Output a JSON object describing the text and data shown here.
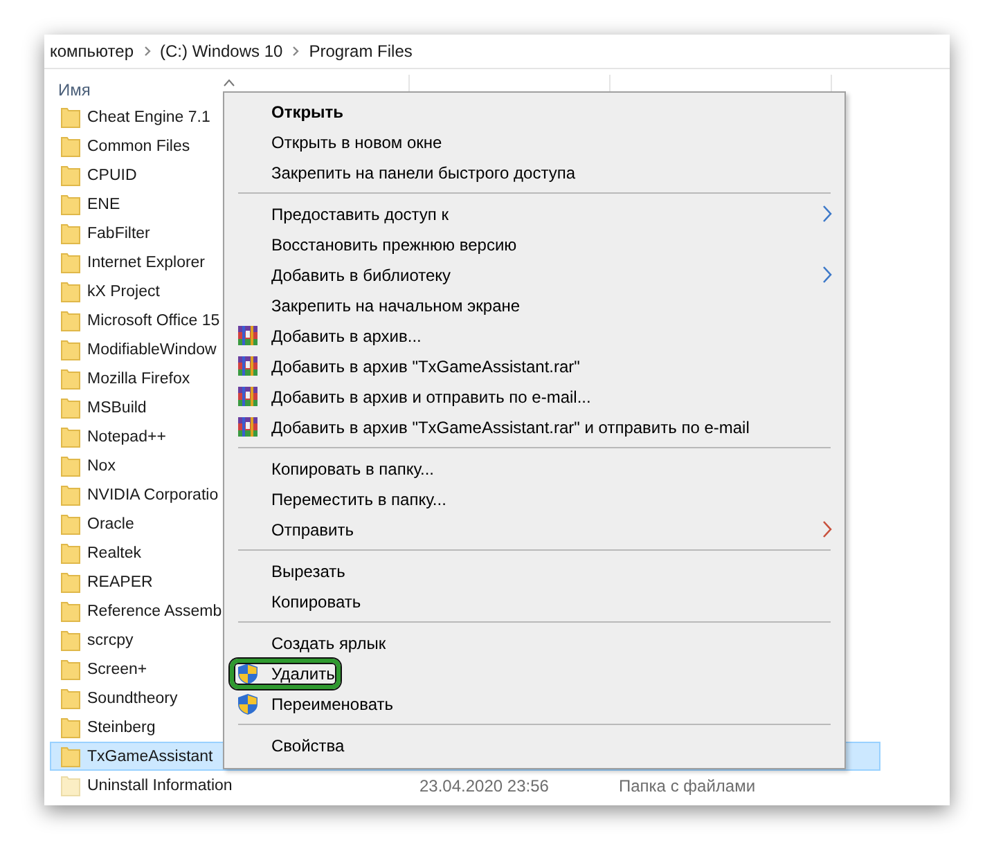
{
  "breadcrumb": [
    "компьютер",
    "(C:) Windows 10",
    "Program Files"
  ],
  "columns": [
    {
      "label": "Имя"
    }
  ],
  "rows": [
    {
      "name": "Cheat Engine 7.1",
      "selected": false,
      "dimmed": false
    },
    {
      "name": "Common Files",
      "selected": false,
      "dimmed": false
    },
    {
      "name": "CPUID",
      "selected": false,
      "dimmed": false
    },
    {
      "name": "ENE",
      "selected": false,
      "dimmed": false
    },
    {
      "name": "FabFilter",
      "selected": false,
      "dimmed": false
    },
    {
      "name": "Internet Explorer",
      "selected": false,
      "dimmed": false
    },
    {
      "name": "kX Project",
      "selected": false,
      "dimmed": false
    },
    {
      "name": "Microsoft Office 15",
      "selected": false,
      "dimmed": false
    },
    {
      "name": "ModifiableWindow",
      "selected": false,
      "dimmed": false
    },
    {
      "name": "Mozilla Firefox",
      "selected": false,
      "dimmed": false
    },
    {
      "name": "MSBuild",
      "selected": false,
      "dimmed": false
    },
    {
      "name": "Notepad++",
      "selected": false,
      "dimmed": false
    },
    {
      "name": "Nox",
      "selected": false,
      "dimmed": false
    },
    {
      "name": "NVIDIA Corporatio",
      "selected": false,
      "dimmed": false
    },
    {
      "name": "Oracle",
      "selected": false,
      "dimmed": false
    },
    {
      "name": "Realtek",
      "selected": false,
      "dimmed": false
    },
    {
      "name": "REAPER",
      "selected": false,
      "dimmed": false
    },
    {
      "name": "Reference Assemb",
      "selected": false,
      "dimmed": false
    },
    {
      "name": "scrcpy",
      "selected": false,
      "dimmed": false
    },
    {
      "name": "Screen+",
      "selected": false,
      "dimmed": false
    },
    {
      "name": "Soundtheory",
      "selected": false,
      "dimmed": false
    },
    {
      "name": "Steinberg",
      "selected": false,
      "dimmed": false
    },
    {
      "name": "TxGameAssistant",
      "selected": true,
      "dimmed": false
    },
    {
      "name": "Uninstall Information",
      "date": "23.04.2020 23:56",
      "type": "Папка с файлами",
      "selected": false,
      "dimmed": true
    }
  ],
  "context_menu": [
    {
      "kind": "item",
      "label": "Открыть",
      "bold": true,
      "highlighted": false,
      "submenu": false
    },
    {
      "kind": "item",
      "label": "Открыть в новом окне",
      "bold": false,
      "highlighted": false,
      "submenu": false
    },
    {
      "kind": "item",
      "label": "Закрепить на панели быстрого доступа",
      "bold": false,
      "highlighted": false,
      "submenu": false
    },
    {
      "kind": "separator"
    },
    {
      "kind": "item",
      "label": "Предоставить доступ к",
      "bold": false,
      "highlighted": false,
      "submenu": true,
      "color": "#3c78c8"
    },
    {
      "kind": "item",
      "label": "Восстановить прежнюю версию",
      "bold": false,
      "highlighted": false,
      "submenu": false
    },
    {
      "kind": "item",
      "label": "Добавить в библиотеку",
      "bold": false,
      "highlighted": false,
      "submenu": true,
      "color": "#3c78c8"
    },
    {
      "kind": "item",
      "label": "Закрепить на начальном экране",
      "bold": false,
      "highlighted": false,
      "submenu": false
    },
    {
      "kind": "archive_item",
      "label": "Добавить в архив...",
      "bold": false,
      "highlighted": false,
      "submenu": false
    },
    {
      "kind": "archive_item",
      "label": "Добавить в архив \"TxGameAssistant.rar\"",
      "bold": false,
      "highlighted": false,
      "submenu": false
    },
    {
      "kind": "archive_item",
      "label": "Добавить в архив и отправить по e-mail...",
      "bold": false,
      "highlighted": false,
      "submenu": false
    },
    {
      "kind": "archive_item",
      "label": "Добавить в архив \"TxGameAssistant.rar\" и отправить по e-mail",
      "bold": false,
      "highlighted": false,
      "submenu": false
    },
    {
      "kind": "separator"
    },
    {
      "kind": "item",
      "label": "Копировать в папку...",
      "bold": false,
      "highlighted": false,
      "submenu": false
    },
    {
      "kind": "item",
      "label": "Переместить в папку...",
      "bold": false,
      "highlighted": false,
      "submenu": false
    },
    {
      "kind": "item",
      "label": "Отправить",
      "bold": false,
      "highlighted": false,
      "submenu": true,
      "color": "#c8503c"
    },
    {
      "kind": "separator"
    },
    {
      "kind": "item",
      "label": "Вырезать",
      "bold": false,
      "highlighted": false,
      "submenu": false
    },
    {
      "kind": "item",
      "label": "Копировать",
      "bold": false,
      "highlighted": false,
      "submenu": false
    },
    {
      "kind": "separator"
    },
    {
      "kind": "item",
      "label": "Создать ярлык",
      "bold": false,
      "highlighted": false,
      "submenu": false
    },
    {
      "kind": "shield_item",
      "label": "Удалить",
      "bold": false,
      "highlighted": true,
      "submenu": false
    },
    {
      "kind": "shield_item",
      "label": "Переименовать",
      "bold": false,
      "highlighted": false,
      "submenu": false
    },
    {
      "kind": "separator"
    },
    {
      "kind": "item",
      "label": "Свойства",
      "bold": false,
      "highlighted": false,
      "submenu": false
    }
  ]
}
